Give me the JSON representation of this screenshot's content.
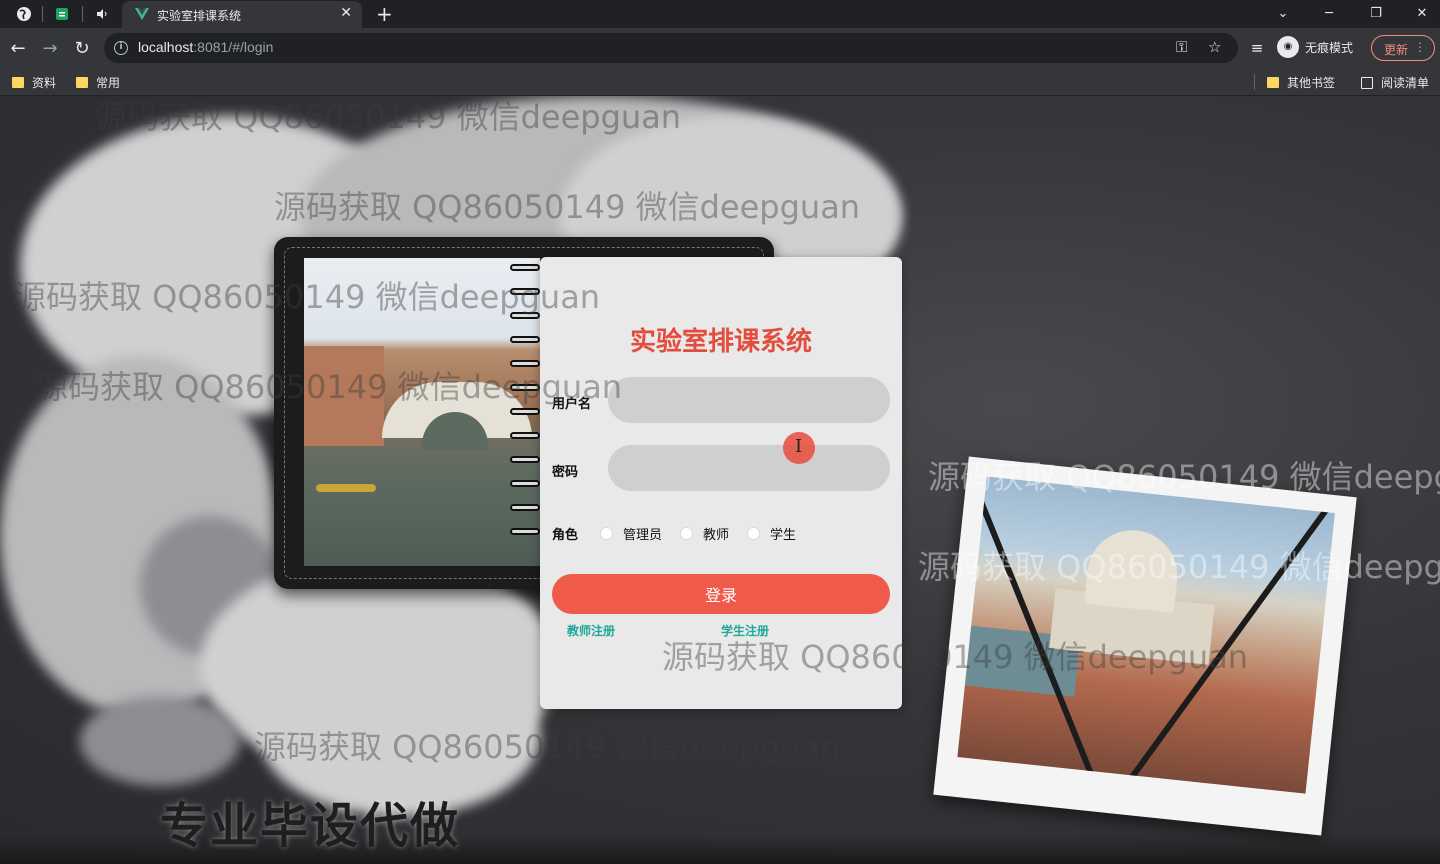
{
  "browser": {
    "tab_title": "实验室排课系统",
    "url_host": "localhost",
    "url_rest": ":8081/#/login",
    "incognito_label": "无痕模式",
    "update_label": "更新",
    "bookmarks": [
      "资料",
      "常用"
    ],
    "bookmarks_right": [
      "其他书签",
      "阅读清单"
    ]
  },
  "login": {
    "title": "实验室排课系统",
    "username_label": "用户名",
    "username_value": "",
    "password_label": "密码",
    "password_value": "",
    "role_label": "角色",
    "roles": [
      "管理员",
      "教师",
      "学生"
    ],
    "submit_label": "登录",
    "teacher_register": "教师注册",
    "student_register": "学生注册"
  },
  "overlay": {
    "watermark": "源码获取 QQ86050149 微信deepguan",
    "watermark_cut": "源码获取 QQ86050149 微信deepgua",
    "slogan": "专业毕设代做"
  },
  "colors": {
    "accent": "#ef5a49",
    "title_color": "#e34d3e",
    "link_color": "#20a898",
    "card_bg": "#e9e9ea"
  }
}
